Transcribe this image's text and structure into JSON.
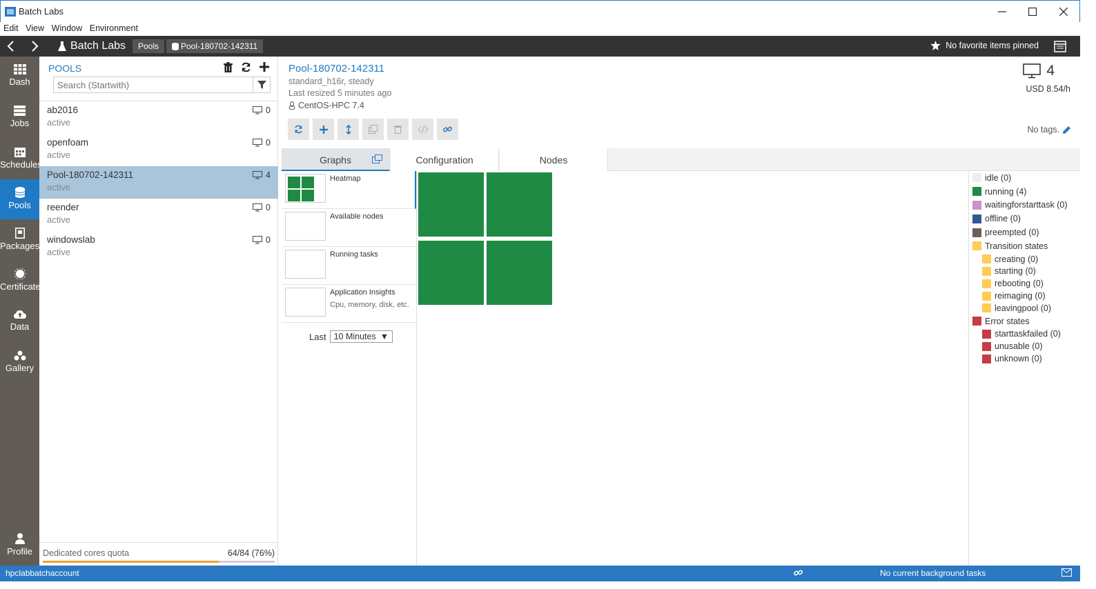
{
  "window": {
    "title": "Batch Labs"
  },
  "menu": [
    "Edit",
    "View",
    "Window",
    "Environment"
  ],
  "header": {
    "brand": "Batch Labs",
    "breadcrumbs": [
      "Pools",
      "Pool-180702-142311"
    ],
    "favorites": "No favorite items pinned"
  },
  "nav": [
    {
      "label": "Dash",
      "icon": "dashboard-icon"
    },
    {
      "label": "Jobs",
      "icon": "jobs-icon"
    },
    {
      "label": "Schedules",
      "icon": "calendar-icon"
    },
    {
      "label": "Pools",
      "icon": "database-icon"
    },
    {
      "label": "Packages",
      "icon": "package-icon"
    },
    {
      "label": "Certificate",
      "icon": "certificate-icon"
    },
    {
      "label": "Data",
      "icon": "cloud-upload-icon"
    },
    {
      "label": "Gallery",
      "icon": "gallery-icon"
    },
    {
      "label": "Profile",
      "icon": "user-icon"
    }
  ],
  "pools": {
    "heading": "POOLS",
    "search_placeholder": "Search (Startwith)",
    "items": [
      {
        "name": "ab2016",
        "state": "active",
        "count": "0"
      },
      {
        "name": "openfoam",
        "state": "active",
        "count": "0"
      },
      {
        "name": "Pool-180702-142311",
        "state": "active",
        "count": "4"
      },
      {
        "name": "reender",
        "state": "active",
        "count": "0"
      },
      {
        "name": "windowslab",
        "state": "active",
        "count": "0"
      }
    ],
    "quota_label": "Dedicated cores quota",
    "quota_value": "64/84 (76%)",
    "quota_fraction": 0.76
  },
  "detail": {
    "title": "Pool-180702-142311",
    "vm_size": "standard_h16r, steady",
    "resized": "Last resized 5 minutes ago",
    "os": "CentOS-HPC 7.4",
    "node_count": "4",
    "cost": "USD 8.54/h",
    "tags": "No tags."
  },
  "tabs": [
    "Graphs",
    "Configuration",
    "Nodes"
  ],
  "graphs": [
    {
      "title": "Heatmap",
      "sub": ""
    },
    {
      "title": "Available nodes",
      "sub": ""
    },
    {
      "title": "Running tasks",
      "sub": ""
    },
    {
      "title": "Application Insights",
      "sub": "Cpu, memory, disk, etc."
    }
  ],
  "last": {
    "label": "Last",
    "value": "10 Minutes"
  },
  "legend": [
    {
      "label": "idle (0)",
      "color": "#eeeeee",
      "sub": false
    },
    {
      "label": "running (4)",
      "color": "#1f8a44",
      "sub": false
    },
    {
      "label": "waitingforstarttask (0)",
      "color": "#c893c8",
      "sub": false
    },
    {
      "label": "offline (0)",
      "color": "#305796",
      "sub": false
    },
    {
      "label": "preempted (0)",
      "color": "#6b5e57",
      "sub": false
    },
    {
      "label": "Transition states",
      "color": "#ffcc55",
      "sub": false
    },
    {
      "label": "creating (0)",
      "color": "#ffcc55",
      "sub": true
    },
    {
      "label": "starting (0)",
      "color": "#ffcc55",
      "sub": true
    },
    {
      "label": "rebooting (0)",
      "color": "#ffcc55",
      "sub": true
    },
    {
      "label": "reimaging (0)",
      "color": "#ffcc55",
      "sub": true
    },
    {
      "label": "leavingpool (0)",
      "color": "#ffcc55",
      "sub": true
    },
    {
      "label": "Error states",
      "color": "#c73b46",
      "sub": false
    },
    {
      "label": "starttaskfailed (0)",
      "color": "#c73b46",
      "sub": true
    },
    {
      "label": "unusable (0)",
      "color": "#c73b46",
      "sub": true
    },
    {
      "label": "unknown (0)",
      "color": "#c73b46",
      "sub": true
    }
  ],
  "status": {
    "account": "hpclabbatchaccount",
    "background": "No current background tasks"
  }
}
